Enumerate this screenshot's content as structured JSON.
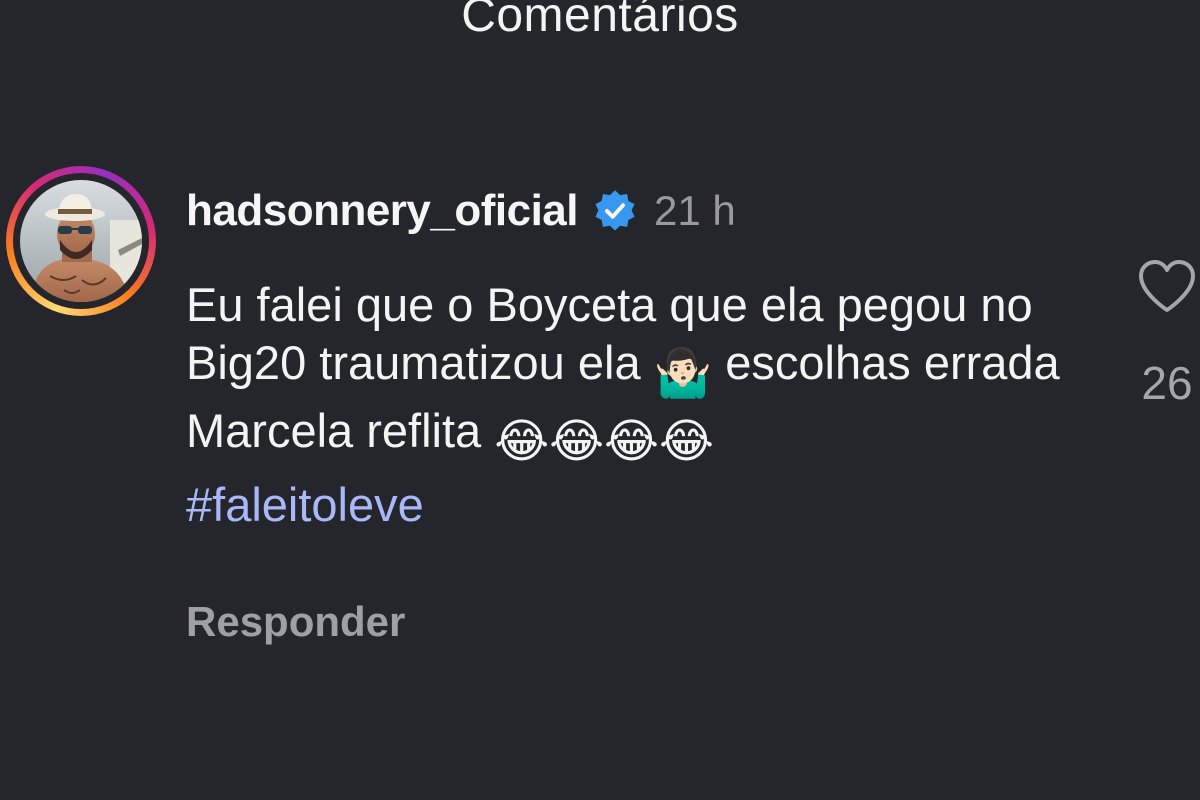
{
  "screen": {
    "title": "Comentários"
  },
  "comment": {
    "username": "hadsonnery_oficial",
    "verified": true,
    "timestamp": "21 h",
    "text_part1": "Eu falei que o Boyceta que ela pegou no Big20 traumatizou ela",
    "emoji_shrug": "🤷🏻‍♂️",
    "text_part2": " escolhas errada Marcela reflita ",
    "emoji_laughs": "😂😂😂😂",
    "hashtag": "#faleitoleve",
    "reply_label": "Responder",
    "like_count": "26"
  },
  "icons": {
    "verified": "verified-badge-icon",
    "like": "heart-icon"
  },
  "colors": {
    "background": "#25262b",
    "hashtag": "#a8b8f8",
    "verified": "#3897f0",
    "muted_text": "#9a9a9e"
  }
}
